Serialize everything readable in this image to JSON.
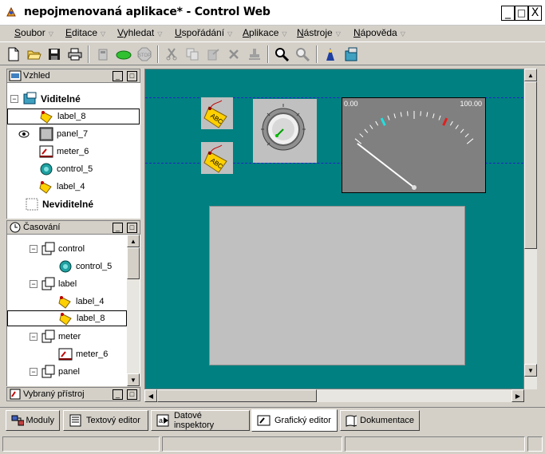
{
  "window": {
    "title": "nepojmenovaná aplikace* - Control Web",
    "min": "_",
    "max": "□",
    "close": "X"
  },
  "menu": [
    {
      "label": "Soubor",
      "key": "S",
      "rest": "oubor"
    },
    {
      "label": "Editace",
      "key": "E",
      "rest": "ditace"
    },
    {
      "label": "Vyhledat",
      "key": "V",
      "rest": "yhledat"
    },
    {
      "label": "Uspořádání",
      "key": "U",
      "rest": "spořádání"
    },
    {
      "label": "Aplikace",
      "key": "A",
      "rest": "plikace"
    },
    {
      "label": "Nástroje",
      "key": "N",
      "rest": "ástroje"
    },
    {
      "label": "Nápověda",
      "key": "N",
      "rest": "ápověda"
    }
  ],
  "panes": {
    "vzhled": {
      "title": "Vzhled",
      "visible_label": "Viditelné",
      "invisible_label": "Neviditelné",
      "items": [
        "label_8",
        "panel_7",
        "meter_6",
        "control_5",
        "label_4"
      ]
    },
    "casovani": {
      "title": "Časování",
      "items": [
        "control",
        "control_5",
        "label",
        "label_4",
        "label_8",
        "meter",
        "meter_6",
        "panel"
      ]
    },
    "vybrany": {
      "title": "Vybraný přístroj"
    }
  },
  "meter": {
    "min_label": "0.00",
    "max_label": "100.00",
    "needle_value": 0.05
  },
  "tabs": [
    "Moduly",
    "Textový editor",
    "Datové inspektory",
    "Grafický editor",
    "Dokumentace"
  ],
  "colors": {
    "canvas": "#008080",
    "chrome": "#d4d0c8"
  }
}
